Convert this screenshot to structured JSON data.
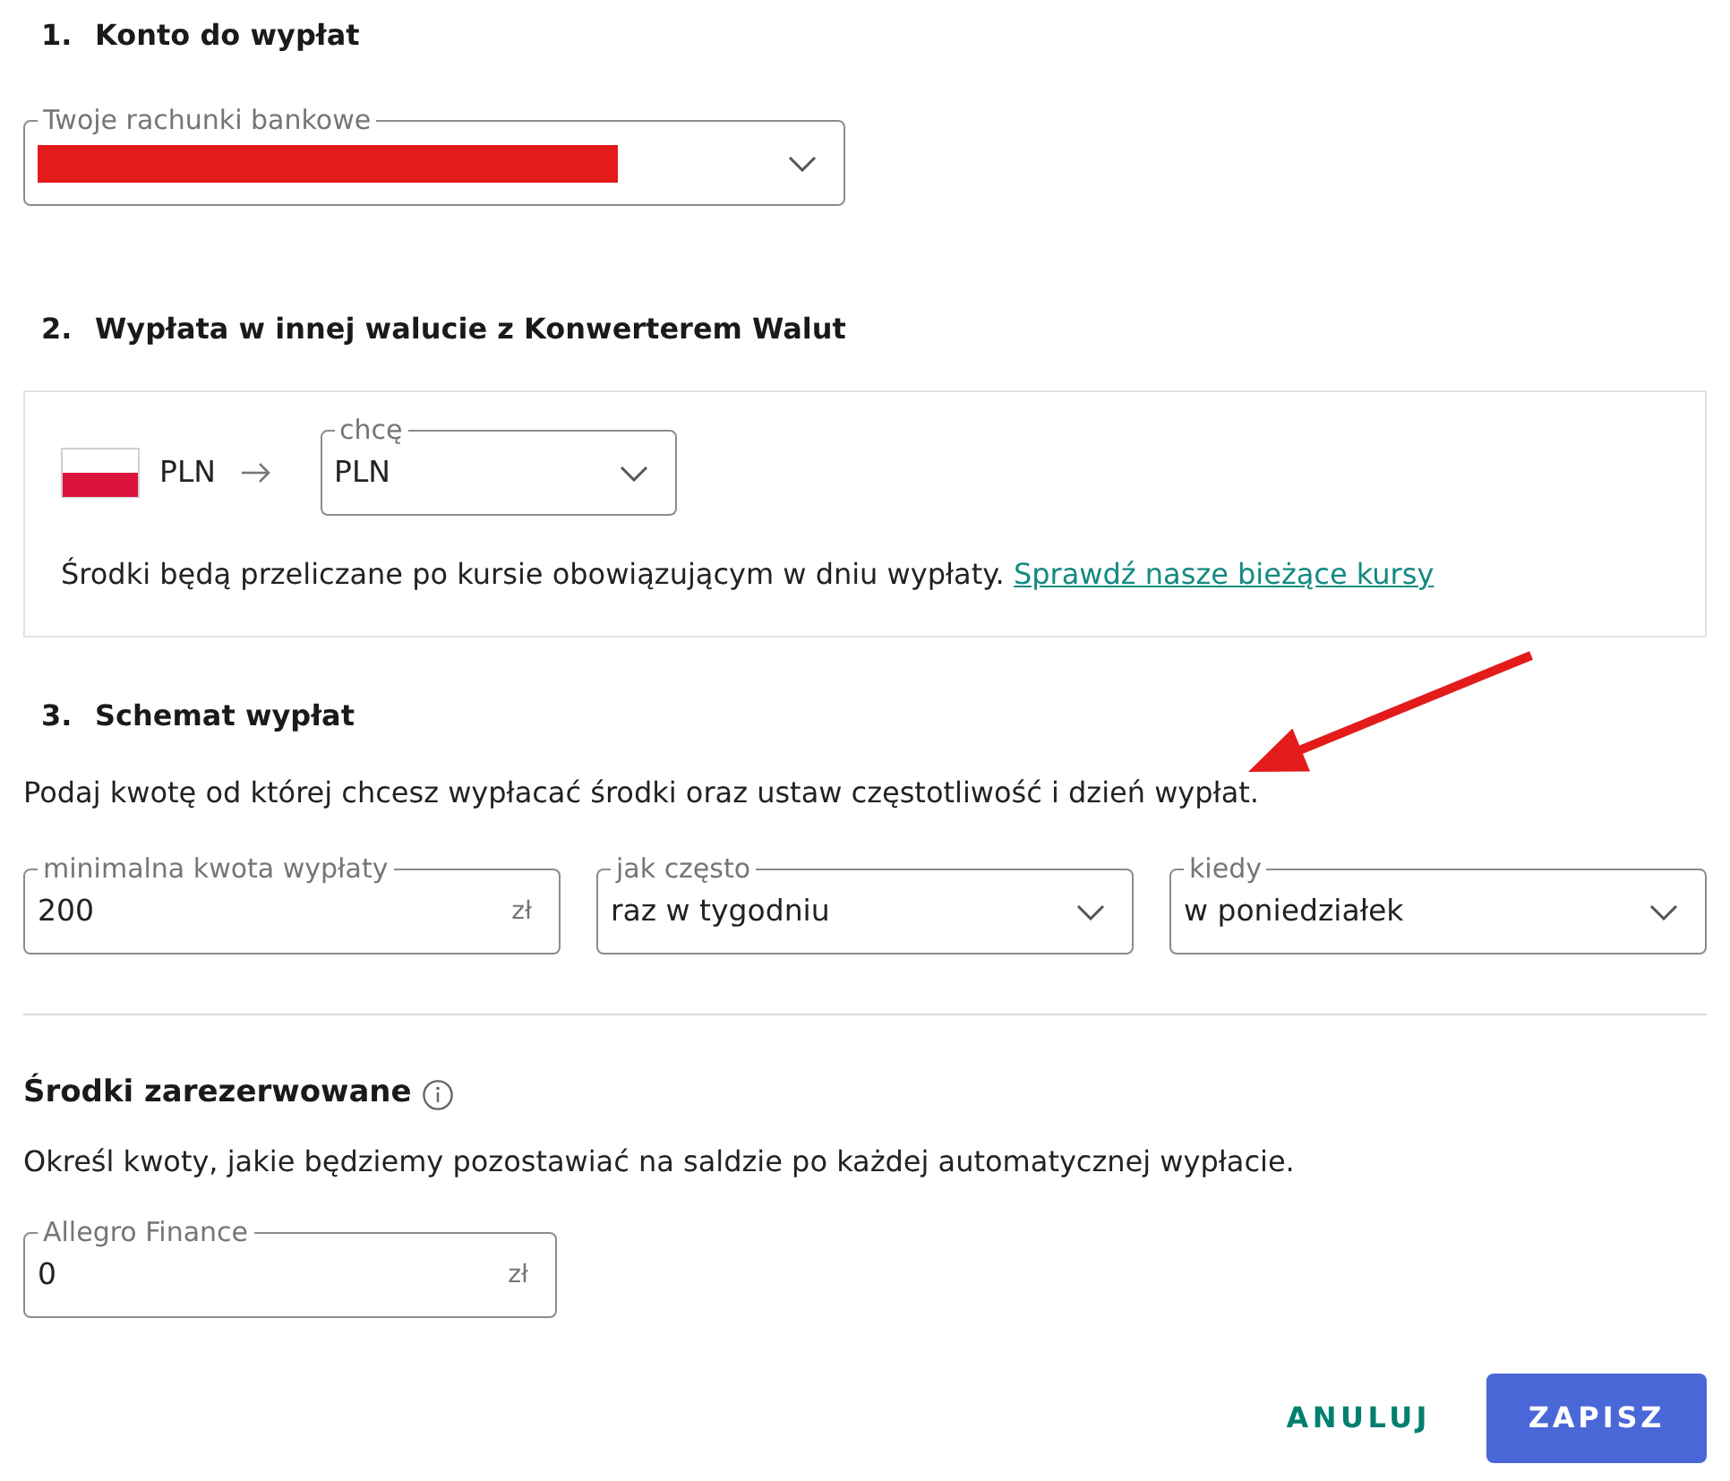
{
  "account": {
    "number": "1.",
    "title": "Konto do wypłat",
    "field": {
      "kind": "select",
      "label": "Twoje rachunki bankowe",
      "redacted": true
    }
  },
  "currency": {
    "number": "2.",
    "title": "Wypłata w innej walucie z Konwerterem Walut",
    "source": "PLN",
    "field": {
      "kind": "select",
      "label": "chcę",
      "value": "PLN"
    },
    "note": "Środki będą przeliczane po kursie obowiązującym w dniu wypłaty.",
    "link": "Sprawdź nasze bieżące kursy"
  },
  "schedule": {
    "number": "3.",
    "title": "Schemat wypłat",
    "description": "Podaj kwotę od której chcesz wypłacać środki oraz ustaw częstotliwość i dzień wypłat.",
    "fields": [
      {
        "kind": "amount",
        "label": "minimalna kwota wypłaty",
        "value": "200",
        "suffix": "zł"
      },
      {
        "kind": "select",
        "label": "jak często",
        "value": "raz w tygodniu"
      },
      {
        "kind": "select",
        "label": "kiedy",
        "value": "w poniedziałek"
      }
    ]
  },
  "reserved": {
    "title": "Środki zarezerwowane",
    "description": "Określ kwoty, jakie będziemy pozostawiać na saldzie po każdej automatycznej wypłacie.",
    "fields": [
      {
        "kind": "amount",
        "label": "Allegro Finance",
        "value": "0",
        "suffix": "zł"
      }
    ]
  },
  "actions": [
    {
      "kind": "secondary",
      "label": "ANULUJ"
    },
    {
      "kind": "primary",
      "label": "ZAPISZ"
    }
  ]
}
